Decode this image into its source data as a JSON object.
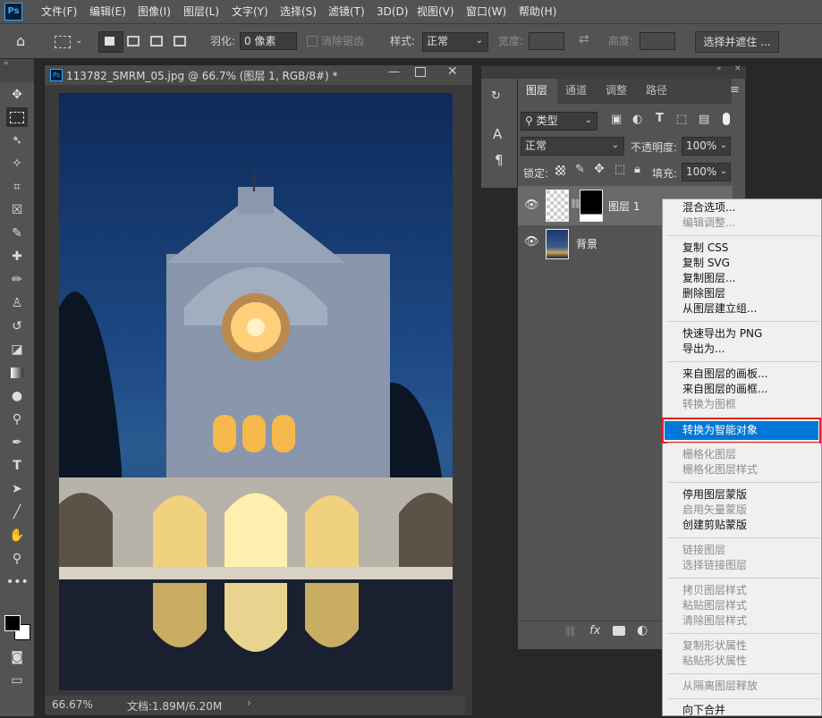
{
  "app": {
    "logo": "Ps",
    "logo_color": "#31a8ff",
    "accent": "#0078d7"
  },
  "menubar": {
    "items": [
      "文件(F)",
      "编辑(E)",
      "图像(I)",
      "图层(L)",
      "文字(Y)",
      "选择(S)",
      "滤镜(T)",
      "3D(D)",
      "视图(V)",
      "窗口(W)",
      "帮助(H)"
    ]
  },
  "options_bar": {
    "feather_label": "羽化:",
    "feather_value": "0 像素",
    "antialias_label": "消除锯齿",
    "style_label": "样式:",
    "style_value": "正常",
    "width_label": "宽度:",
    "height_label": "高度:",
    "select_mask_button": "选择并遮住 ..."
  },
  "document": {
    "tab_title": "113782_SMRM_05.jpg @ 66.7% (图层 1, RGB/8#) *",
    "zoom": "66.67%",
    "doc_info": "文档:1.89M/6.20M"
  },
  "layers_panel": {
    "tabs": [
      "图层",
      "通道",
      "调整",
      "路径"
    ],
    "filter_kind": "类型",
    "blend_mode": "正常",
    "opacity_label": "不透明度:",
    "opacity_value": "100%",
    "lock_label": "锁定:",
    "fill_label": "填充:",
    "fill_value": "100%",
    "layers": [
      {
        "name": "图层 1",
        "visible": true,
        "has_mask": true
      },
      {
        "name": "背景",
        "visible": true,
        "has_mask": false
      }
    ]
  },
  "context_menu": {
    "items": [
      {
        "label": "混合选项...",
        "enabled": true
      },
      {
        "label": "编辑调整...",
        "enabled": false
      },
      {
        "label": "复制 CSS",
        "enabled": true
      },
      {
        "label": "复制 SVG",
        "enabled": true
      },
      {
        "label": "复制图层...",
        "enabled": true
      },
      {
        "label": "删除图层",
        "enabled": true
      },
      {
        "label": "从图层建立组...",
        "enabled": true
      },
      {
        "label": "快速导出为 PNG",
        "enabled": true
      },
      {
        "label": "导出为...",
        "enabled": true
      },
      {
        "label": "来自图层的画板...",
        "enabled": true
      },
      {
        "label": "来自图层的画框...",
        "enabled": true
      },
      {
        "label": "转换为图框",
        "enabled": false
      },
      {
        "label": "转换为智能对象",
        "enabled": true,
        "highlighted": true
      },
      {
        "label": "栅格化图层",
        "enabled": false
      },
      {
        "label": "栅格化图层样式",
        "enabled": false
      },
      {
        "label": "停用图层蒙版",
        "enabled": true
      },
      {
        "label": "启用矢量蒙版",
        "enabled": false
      },
      {
        "label": "创建剪贴蒙版",
        "enabled": true
      },
      {
        "label": "链接图层",
        "enabled": false
      },
      {
        "label": "选择链接图层",
        "enabled": false
      },
      {
        "label": "拷贝图层样式",
        "enabled": false
      },
      {
        "label": "粘贴图层样式",
        "enabled": false
      },
      {
        "label": "清除图层样式",
        "enabled": false
      },
      {
        "label": "复制形状属性",
        "enabled": false
      },
      {
        "label": "粘贴形状属性",
        "enabled": false
      },
      {
        "label": "从隔离图层释放",
        "enabled": false
      },
      {
        "label": "向下合并",
        "enabled": true
      }
    ],
    "highlight_border_color": "#e8201e"
  }
}
